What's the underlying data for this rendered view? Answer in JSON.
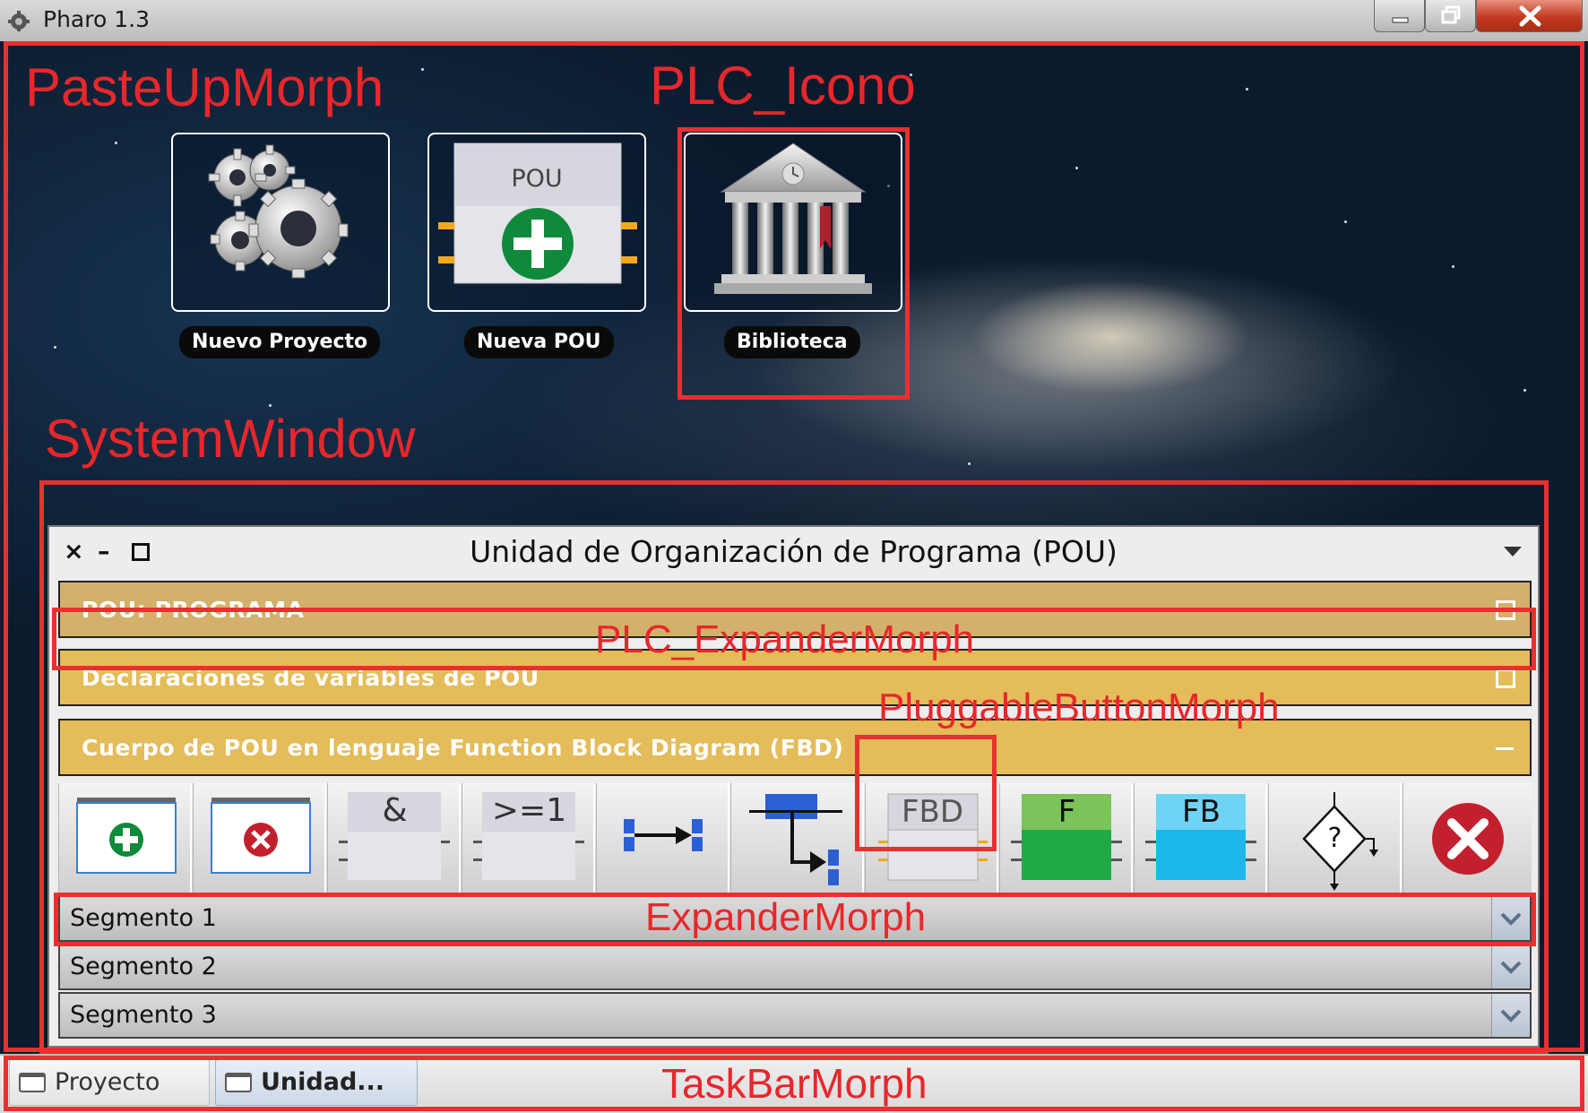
{
  "os_window": {
    "title": "Pharo 1.3",
    "controls": [
      "minimize-icon",
      "maximize-icon",
      "close-icon"
    ]
  },
  "desktop": {
    "icons": [
      {
        "label": "Nuevo Proyecto",
        "icon": "gears-icon"
      },
      {
        "label": "Nueva POU",
        "icon": "pou-add-icon",
        "block_text": "POU"
      },
      {
        "label": "Biblioteca",
        "icon": "library-building-icon"
      }
    ]
  },
  "system_window": {
    "title": "Unidad de Organización de Programa (POU)",
    "controls": {
      "close": "×",
      "minimize": "–"
    },
    "bands": [
      {
        "label": "POU: PROGRAMA",
        "color": "#d3b16a",
        "state": "collapsed"
      },
      {
        "label": "Declaraciones de variables de POU",
        "color": "#e4bc5a",
        "state": "collapsed"
      },
      {
        "label": "Cuerpo de POU en lenguaje Function Block Diagram (FBD)",
        "color": "#e4bc5a",
        "state": "expanded"
      }
    ],
    "toolbar": [
      {
        "name": "add-network-button",
        "icon": "add-window-icon"
      },
      {
        "name": "remove-network-button",
        "icon": "remove-window-icon"
      },
      {
        "name": "and-block-button",
        "text": "&"
      },
      {
        "name": "or-block-button",
        "text": ">=1"
      },
      {
        "name": "connection-button",
        "icon": "connection-arrow-icon"
      },
      {
        "name": "branch-button",
        "icon": "branch-arrow-icon"
      },
      {
        "name": "fbd-block-button",
        "text": "FBD"
      },
      {
        "name": "function-block-button",
        "text": "F",
        "color": "#1faa47"
      },
      {
        "name": "fb-block-button",
        "text": "FB",
        "color": "#1cb8ea"
      },
      {
        "name": "condition-button",
        "text": "?"
      },
      {
        "name": "delete-button",
        "icon": "delete-icon"
      }
    ],
    "segments": [
      "Segmento 1",
      "Segmento 2",
      "Segmento 3"
    ]
  },
  "taskbar": {
    "tasks": [
      {
        "label": "Proyecto",
        "active": false
      },
      {
        "label": "Unidad...",
        "active": true
      }
    ]
  },
  "annotations": {
    "paste_up_morph": "PasteUpMorph",
    "plc_icono": "PLC_Icono",
    "system_window": "SystemWindow",
    "plc_expander_morph": "PLC_ExpanderMorph",
    "pluggable_button_morph": "PluggableButtonMorph",
    "expander_morph": "ExpanderMorph",
    "task_bar_morph": "TaskBarMorph",
    "color": "#e8272b"
  }
}
